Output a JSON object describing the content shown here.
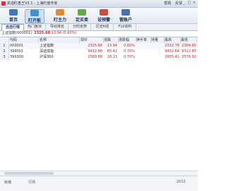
{
  "window": {
    "title": "凯迪盯盘王V3.1 - 上海盯盘专家",
    "menu_links": [
      "帮助",
      "反馈"
    ],
    "buttons": [
      "_",
      "□",
      "×"
    ]
  },
  "toolbar": [
    {
      "label": "首页",
      "icon": "home-icon",
      "color": "#3a79c8"
    },
    {
      "label": "盯开板",
      "icon": "monitor-icon",
      "color": "#3d8fd6",
      "active": true
    },
    {
      "label": "盯主力",
      "icon": "chart-icon",
      "color": "#e08a2a"
    },
    {
      "label": "定买卖",
      "icon": "trade-icon",
      "color": "#5fae3a"
    },
    {
      "label": "设预警",
      "icon": "alarm-icon",
      "color": "#d04a3a"
    },
    {
      "label": "管账户",
      "icon": "account-icon",
      "color": "#4a6fc0"
    }
  ],
  "tabs": [
    "自选行情",
    "热门板块",
    "导动排名",
    "分时走势",
    "历史K线",
    "F10资料"
  ],
  "info": {
    "prefix": "上证指数(000001):",
    "value": "2325.68",
    "change": "13.94 (0.60%)"
  },
  "table": {
    "headers": [
      "代码",
      "名称",
      "现价",
      "涨跌",
      "涨跌幅",
      "换手率",
      "持量",
      "最高",
      "最低"
    ],
    "rows": [
      {
        "idx": "1",
        "code": "000001",
        "name": "上证指数",
        "price": "2325.68",
        "chg": "13.94",
        "pct": "0.60%",
        "turnover": "",
        "vol": "",
        "high": "2332.78",
        "low": "2304.65"
      },
      {
        "idx": "2",
        "code": "399001",
        "name": "深证成指",
        "price": "9432.88",
        "chg": "65.42",
        "pct": "0.70%",
        "turnover": "",
        "vol": "",
        "high": "9432.64",
        "low": "9312.87"
      },
      {
        "idx": "3",
        "code": "399300",
        "name": "沪深300",
        "price": "2589.88",
        "chg": "18.13",
        "pct": "0.70%",
        "turnover": "",
        "vol": "",
        "high": "2605.41",
        "low": "2576.92"
      }
    ]
  },
  "status": [
    "就绪",
    "行情",
    "",
    "2012"
  ]
}
